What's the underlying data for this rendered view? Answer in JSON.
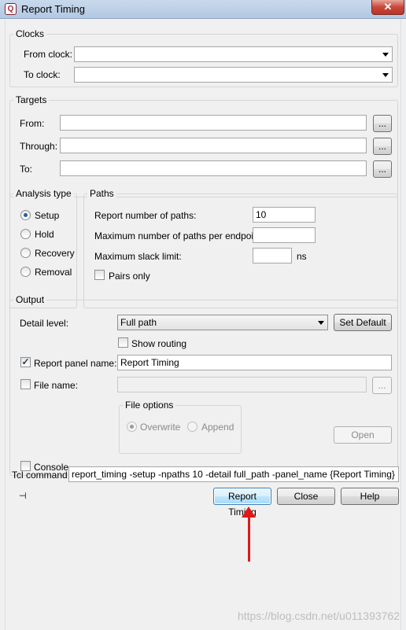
{
  "window": {
    "title": "Report Timing",
    "close_glyph": "✕",
    "app_icon_glyph": "Q"
  },
  "clocks": {
    "title": "Clocks",
    "from_label": "From clock:",
    "from_value": "",
    "to_label": "To clock:",
    "to_value": ""
  },
  "targets": {
    "title": "Targets",
    "from_label": "From:",
    "through_label": "Through:",
    "to_label": "To:",
    "browse_label": "..."
  },
  "analysis": {
    "title": "Analysis type",
    "options": [
      "Setup",
      "Hold",
      "Recovery",
      "Removal"
    ],
    "selected": "Setup"
  },
  "paths": {
    "title": "Paths",
    "num_paths_label": "Report number of paths:",
    "num_paths_value": "10",
    "max_per_endpoint_label": "Maximum number of paths per endpoint:",
    "max_per_endpoint_value": "",
    "max_slack_label": "Maximum slack limit:",
    "max_slack_value": "",
    "slack_unit": "ns",
    "pairs_only_label": "Pairs only"
  },
  "output": {
    "title": "Output",
    "detail_label": "Detail level:",
    "detail_value": "Full path",
    "set_default_label": "Set Default",
    "show_routing_label": "Show routing",
    "panel_name_label": "Report panel name:",
    "panel_name_value": "Report Timing",
    "file_name_label": "File name:",
    "file_name_value": "",
    "browse_label": "...",
    "file_options_title": "File options",
    "overwrite_label": "Overwrite",
    "append_label": "Append",
    "open_label": "Open",
    "console_label": "Console"
  },
  "tcl": {
    "label": "Tcl command:",
    "value": "report_timing -setup -npaths 10 -detail full_path -panel_name {Report Timing}"
  },
  "buttons": {
    "report_timing": "Report Timing",
    "close": "Close",
    "help": "Help"
  },
  "check_glyph": "✓",
  "pin_glyph": "⊣",
  "watermark": "https://blog.csdn.net/u011393762",
  "colors": {
    "annotation_arrow": "#e01818",
    "focus_button_border": "#3c7fb1"
  }
}
